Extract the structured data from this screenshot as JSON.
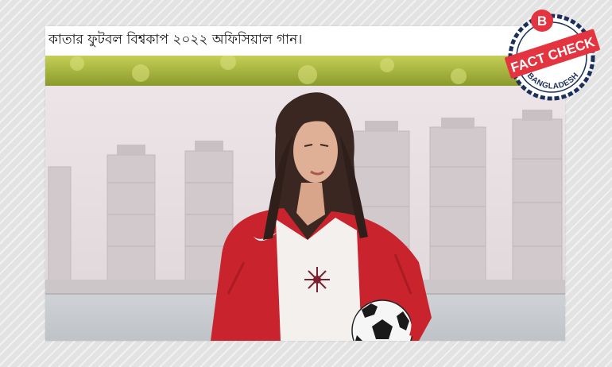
{
  "post": {
    "text": "কাতার ফুটবল বিশ্বকাপ ২০২২ অফিসিয়াল গান।"
  },
  "badge": {
    "letter": "B",
    "title": "FACT CHECK",
    "subtitle": "BANGLADESH",
    "colors": {
      "red": "#e3343f",
      "navy": "#1c2e5a",
      "white": "#ffffff"
    }
  },
  "video": {
    "subject_colors": {
      "jacket": "#c9242d",
      "shirt": "#f3f0ee",
      "sky": "#e7dde2",
      "foliage": "#a8b838"
    }
  }
}
